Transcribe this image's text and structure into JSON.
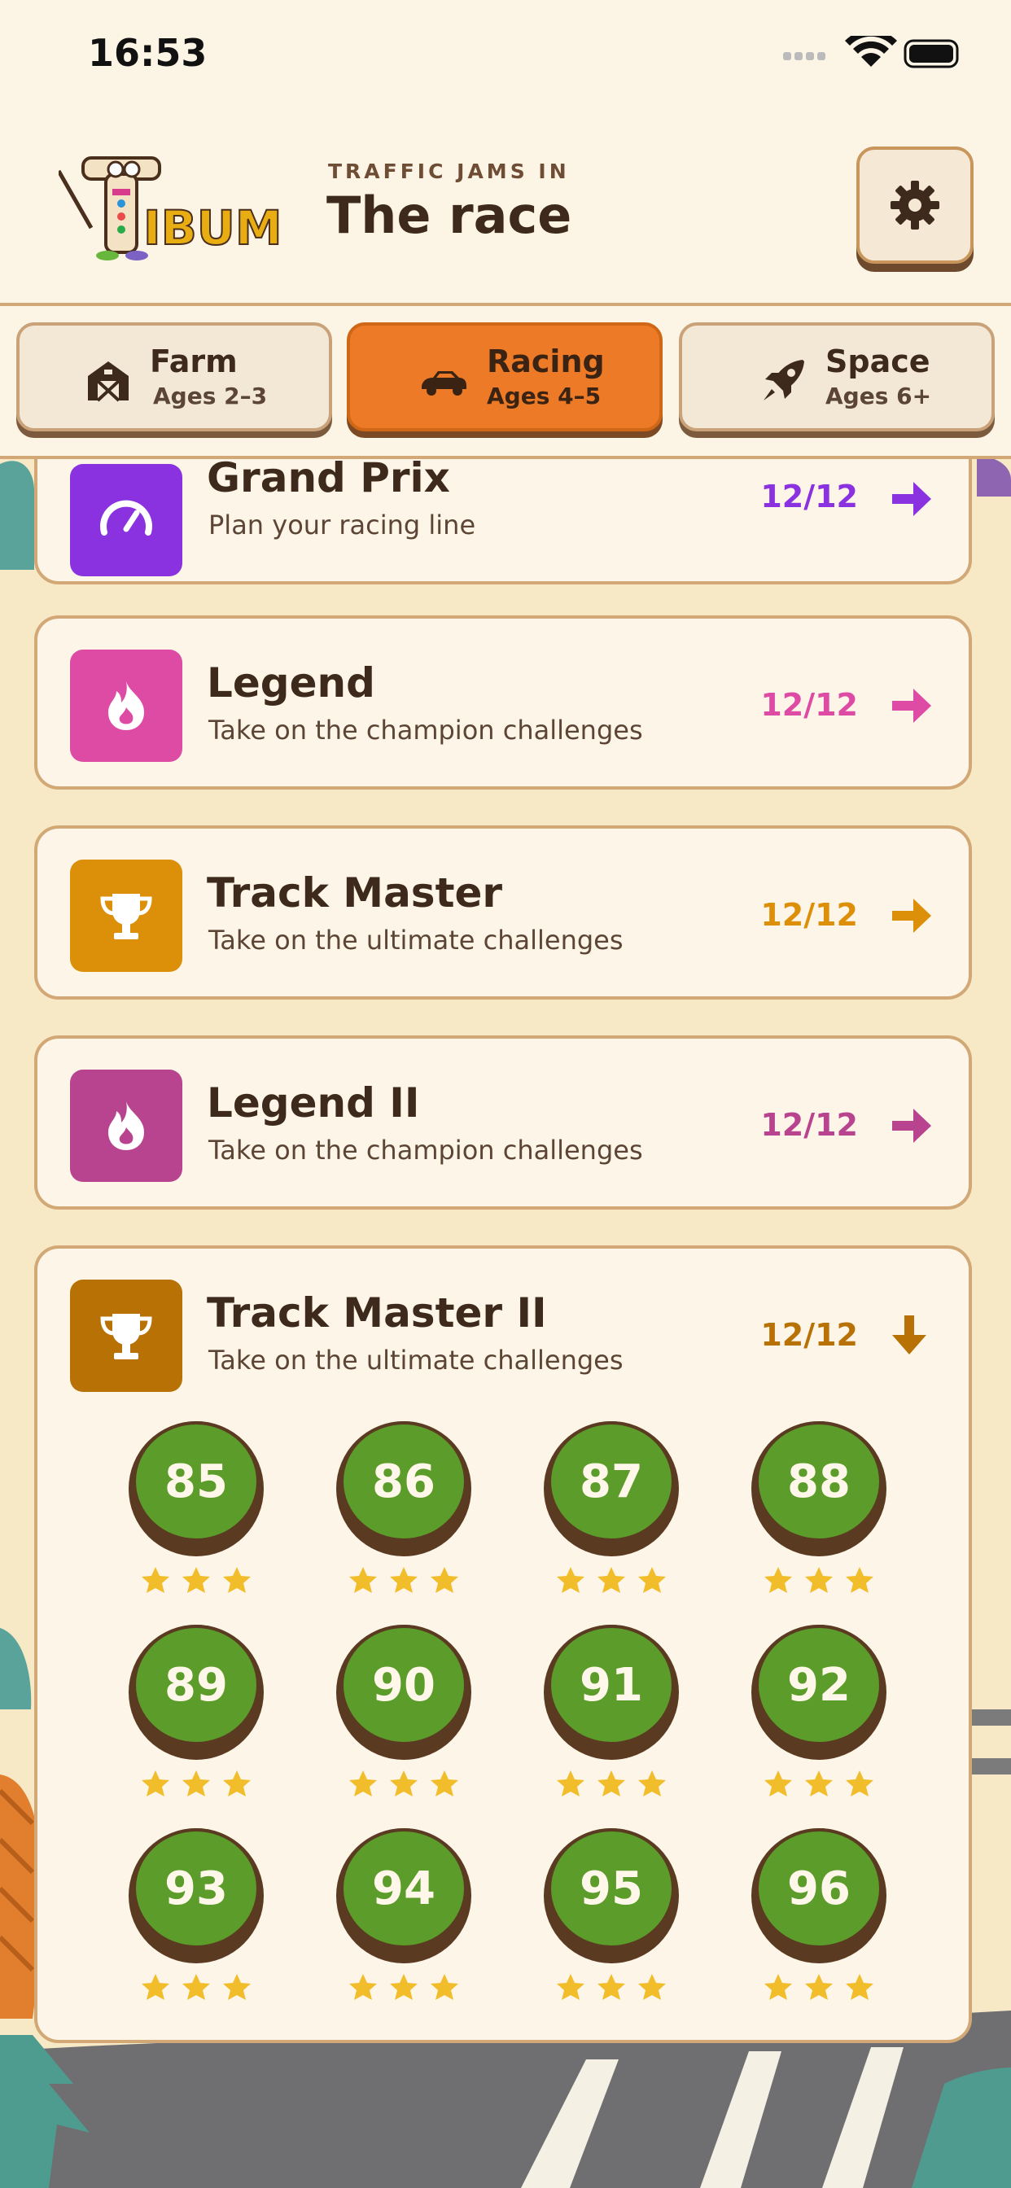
{
  "status_bar": {
    "time": "16:53"
  },
  "header": {
    "logo_text": "IBUMO",
    "subtitle": "TRAFFIC JAMS IN",
    "title": "The race"
  },
  "tabs": [
    {
      "label": "Farm",
      "sub": "Ages 2–3",
      "icon": "barn-icon",
      "active": false
    },
    {
      "label": "Racing",
      "sub": "Ages 4–5",
      "icon": "car-icon",
      "active": true
    },
    {
      "label": "Space",
      "sub": "Ages 6+",
      "icon": "rocket-icon",
      "active": false
    }
  ],
  "packs": [
    {
      "title": "Grand Prix",
      "desc": "Plan your racing line",
      "progress": "12/12",
      "color": "#8a32e0",
      "icon": "speedometer-icon"
    },
    {
      "title": "Legend",
      "desc": "Take on the champion challenges",
      "progress": "12/12",
      "color": "#de4ba4",
      "icon": "flame-icon"
    },
    {
      "title": "Track Master",
      "desc": "Take on the ultimate challenges",
      "progress": "12/12",
      "color": "#dc8f08",
      "icon": "trophy-icon"
    },
    {
      "title": "Legend II",
      "desc": "Take on the champion challenges",
      "progress": "12/12",
      "color": "#b8438f",
      "icon": "flame-icon"
    },
    {
      "title": "Track Master II",
      "desc": "Take on the ultimate challenges",
      "progress": "12/12",
      "color": "#b87105",
      "icon": "trophy-icon"
    }
  ],
  "levels": [
    {
      "number": "85",
      "stars": 3
    },
    {
      "number": "86",
      "stars": 3
    },
    {
      "number": "87",
      "stars": 3
    },
    {
      "number": "88",
      "stars": 3
    },
    {
      "number": "89",
      "stars": 3
    },
    {
      "number": "90",
      "stars": 3
    },
    {
      "number": "91",
      "stars": 3
    },
    {
      "number": "92",
      "stars": 3
    },
    {
      "number": "93",
      "stars": 3
    },
    {
      "number": "94",
      "stars": 3
    },
    {
      "number": "95",
      "stars": 3
    },
    {
      "number": "96",
      "stars": 3
    }
  ],
  "colors": {
    "tab_active": "#ec7a27",
    "level_green": "#5b9c2a",
    "star": "#f2bd2a"
  }
}
